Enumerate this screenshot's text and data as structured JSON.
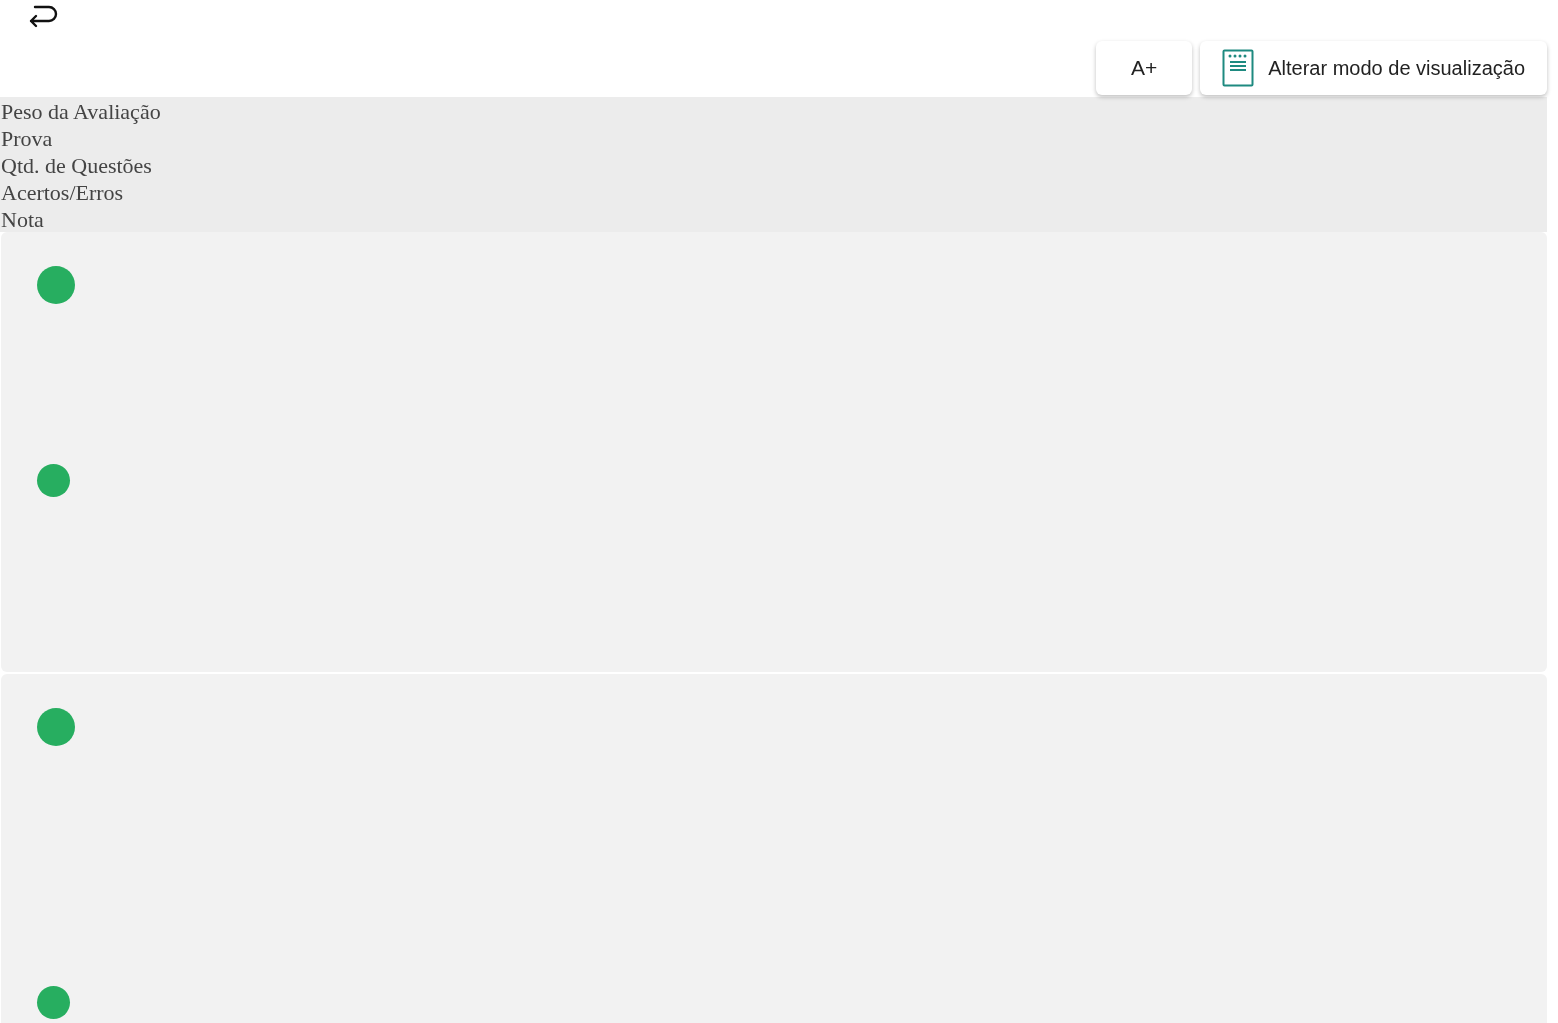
{
  "toolbar": {
    "font_button": {
      "label": "A+"
    },
    "view_mode_button": {
      "label": "Alterar modo de visualização"
    }
  },
  "summary_labels": [
    "Peso da Avaliação",
    "Prova",
    "Qtd. de Questões",
    "Acertos/Erros",
    "Nota"
  ],
  "cards": [
    {
      "dots": [
        {
          "kind": "large",
          "color": "#27ae60"
        },
        {
          "kind": "small",
          "color": "#27ae60"
        }
      ]
    },
    {
      "dots": [
        {
          "kind": "large",
          "color": "#27ae60"
        },
        {
          "kind": "small",
          "color": "#27ae60"
        }
      ]
    }
  ]
}
